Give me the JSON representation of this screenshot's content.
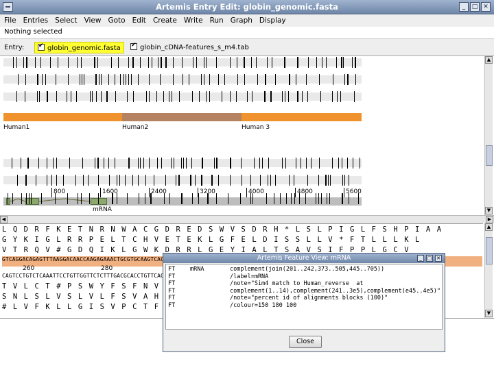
{
  "window": {
    "title": "Artemis Entry Edit: globin_genomic.fasta",
    "controls": [
      "_",
      "□",
      "✕"
    ]
  },
  "menu": [
    "File",
    "Entries",
    "Select",
    "View",
    "Goto",
    "Edit",
    "Create",
    "Write",
    "Run",
    "Graph",
    "Display"
  ],
  "status": "Nothing selected",
  "entries": {
    "label": "Entry:",
    "items": [
      {
        "name": "globin_genomic.fasta",
        "checked": true,
        "active": true
      },
      {
        "name": "globin_cDNA-features_s_m4.tab",
        "checked": true,
        "active": false
      }
    ]
  },
  "overview": {
    "genes": [
      {
        "label": "Human1",
        "color": "#f0922d"
      },
      {
        "label": "Human2",
        "color": "#b58362"
      },
      {
        "label": "Human 3",
        "color": "#f0922d"
      }
    ],
    "ruler": [
      "800",
      "1600",
      "2400",
      "3200",
      "4000",
      "4800",
      "5600"
    ],
    "feature_label": "mRNA"
  },
  "sequence": {
    "aa_rows": [
      "L Q D R F K E T N R N W A C G D R E D S W V S D R H * L S L P I G L F S H P I A A",
      "G Y K I G L R R P E L T C H V E T E K L G F E L D I S S L L V * F T L L L K L",
      "V T R Q V # G D Q I K L G W K D R R L G E Y I A L T S A V S I F P P L G C V"
    ],
    "dna_top": "GTCAGGACAGAGTTTAAGGACAACCAAGAGAAACTGCGTGCAAGTCACGGACCAGACGTCACATTTACGGTAGCTGCATGGGCTCCGACTCTACCCAGCTACAGGTCATTCACCTCC",
    "dna_bottom": "CAGTCCTGTCTCAAATTCCTGTTGGTTCTCTTTGACGCACCTGTTCAGTGCCTGGTCTGCAGTGTAAATGCCATCGACGTACCCGAGGCTGAGATGGGTCGATGTCCAGTAAGTGGAGG",
    "pos_labels": [
      "260",
      "280"
    ],
    "aa_rows_bottom": [
      "T V L C T # P S W Y F S F N V R L T Q V S S H V P N S Y Q T M G H Y P Q Q",
      "S N L S L V S L V L F S V A H L N M N V T L A L G S T D A L V R T P C E V",
      "# L V F K L L G I S V P C T F P L V R G R H L S R L R K H R G L E L L S S"
    ]
  },
  "feature_view": {
    "title": "Artemis Feature View: mRNA",
    "lines": [
      {
        "c1": "FT",
        "c2": "mRNA",
        "c3": "complement(join(201..242,373..505,445..705))"
      },
      {
        "c1": "FT",
        "c2": "",
        "c3": "/label=mRNA"
      },
      {
        "c1": "FT",
        "c2": "",
        "c3": "/note=\"Sim4 match to Human_reverse  at"
      },
      {
        "c1": "FT",
        "c2": "",
        "c3": "complement(1..14),complement(241..3e5),complement(e45..4e5)\""
      },
      {
        "c1": "FT",
        "c2": "",
        "c3": "/note=\"percent id of alignments blocks (100)\""
      },
      {
        "c1": "FT",
        "c2": "",
        "c3": "/colour=150 180 100"
      }
    ],
    "close_label": "Close",
    "controls": [
      "_",
      "□",
      "✕"
    ]
  },
  "colors": {
    "gene_orange": "#f0922d",
    "gene_brown": "#b58362",
    "exon_green": "#8ca86c",
    "selection_yellow": "#ffff33",
    "dna_highlight": "#f1b080"
  }
}
